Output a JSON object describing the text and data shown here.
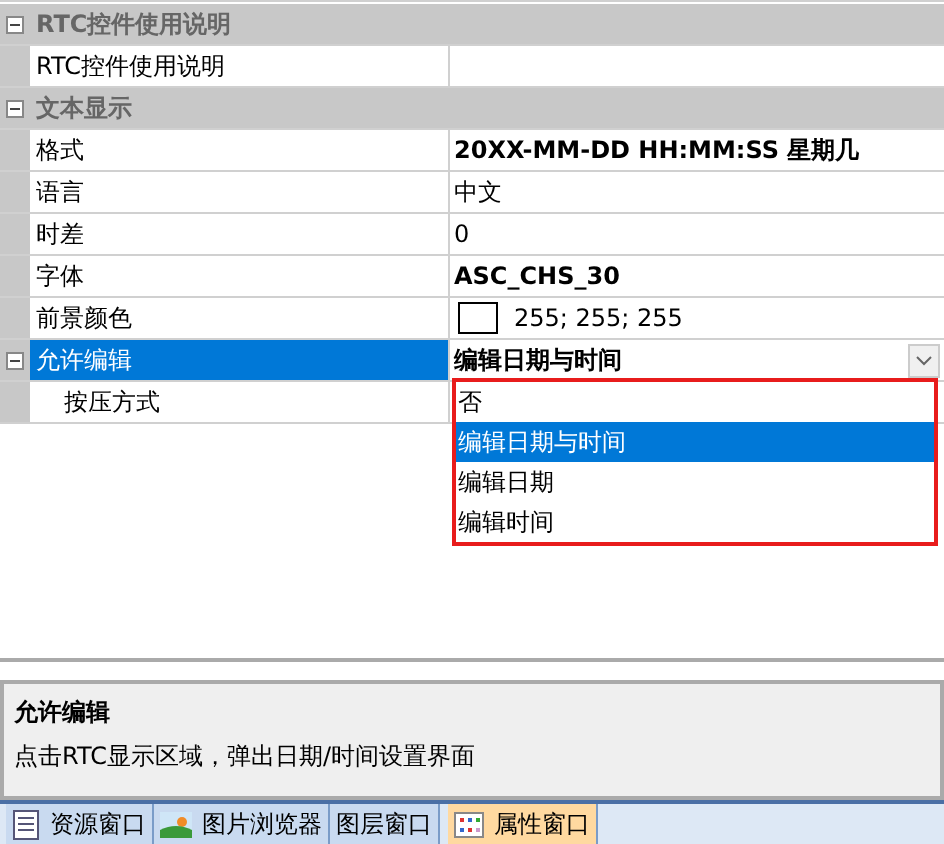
{
  "property_grid": {
    "categories": [
      {
        "name": "RTC控件使用说明",
        "expanded": true,
        "rows": [
          {
            "name": "RTC控件使用说明",
            "selected": false
          }
        ]
      },
      {
        "name": "文本显示",
        "expanded": true,
        "rows": [
          {
            "name": "格式",
            "kind": "text",
            "value": "20XX-MM-DD HH:MM:SS 星期几",
            "bold": true,
            "selected": false
          },
          {
            "name": "语言",
            "kind": "text",
            "value": "中文",
            "bold": false,
            "selected": false
          },
          {
            "name": "时差",
            "kind": "text",
            "value": "0",
            "bold": false,
            "selected": false
          },
          {
            "name": "字体",
            "kind": "text",
            "value": "ASC_CHS_30",
            "bold": true,
            "selected": false
          },
          {
            "name": "前景颜色",
            "kind": "color",
            "value": "255; 255; 255",
            "color": "#ffffff",
            "bold": false,
            "selected": false
          },
          {
            "name": "允许编辑",
            "kind": "dropdown",
            "value": "编辑日期与时间",
            "bold": true,
            "selected": true,
            "expanded": true,
            "children": [
              {
                "name": "按压方式",
                "selected": false
              }
            ]
          }
        ]
      }
    ]
  },
  "dropdown_options": [
    {
      "label": "否",
      "selected": false
    },
    {
      "label": "编辑日期与时间",
      "selected": true
    },
    {
      "label": "编辑日期",
      "selected": false
    },
    {
      "label": "编辑时间",
      "selected": false
    }
  ],
  "description": {
    "title": "允许编辑",
    "text": "点击RTC显示区域，弹出日期/时间设置界面"
  },
  "tabs": [
    {
      "label": "资源窗口",
      "selected": false
    },
    {
      "label": "图片浏览器",
      "selected": false
    },
    {
      "label": "图层窗口",
      "selected": false
    },
    {
      "label": "属性窗口",
      "selected": true
    }
  ]
}
